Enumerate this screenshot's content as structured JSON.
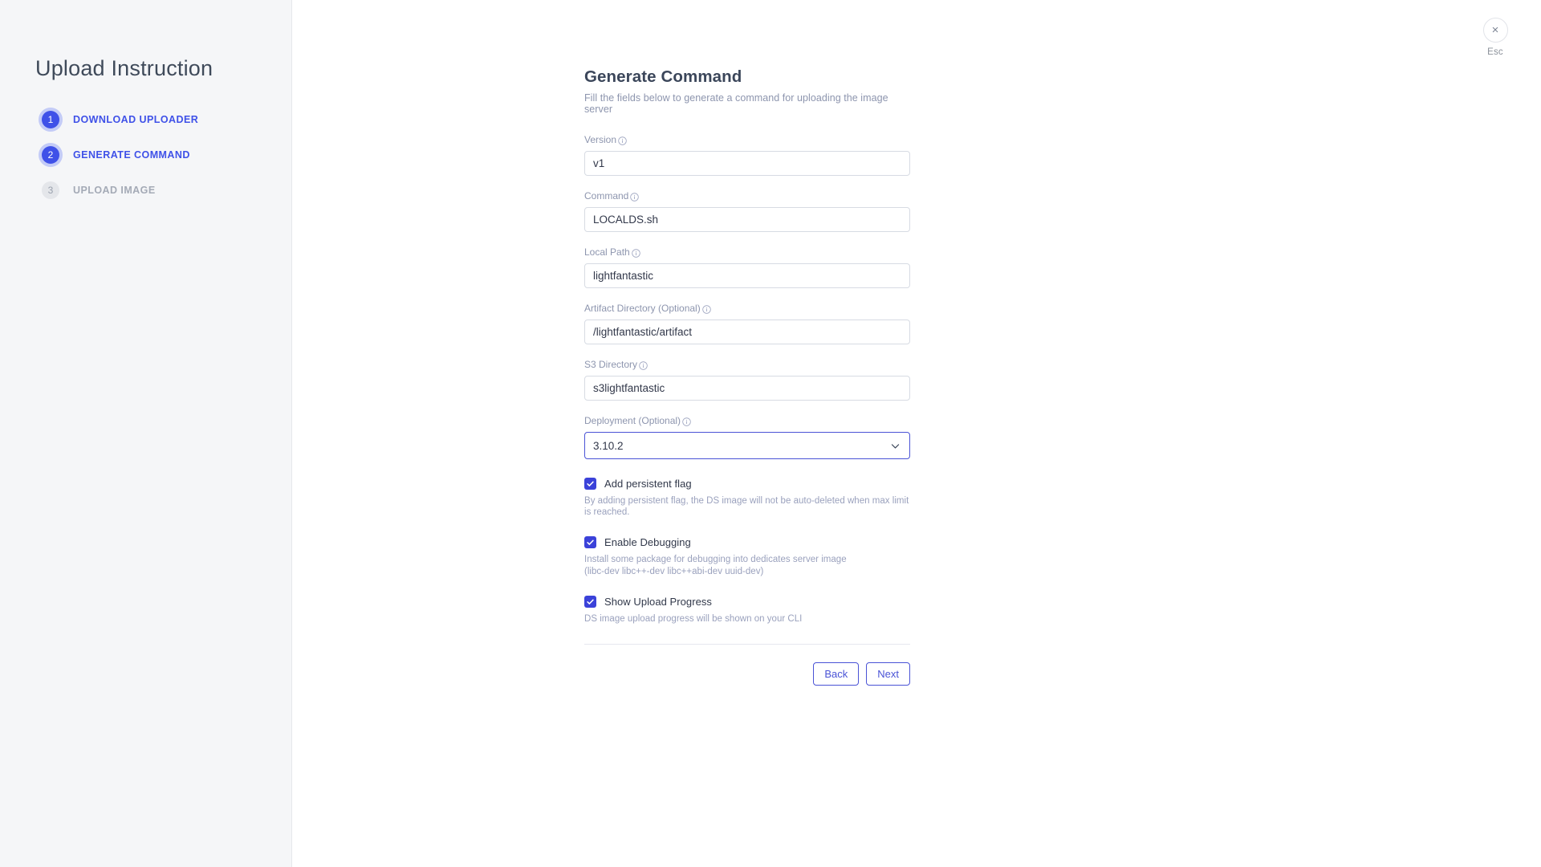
{
  "sidebar": {
    "title": "Upload Instruction",
    "steps": [
      {
        "number": "1",
        "label": "DOWNLOAD UPLOADER",
        "state": "done"
      },
      {
        "number": "2",
        "label": "GENERATE COMMAND",
        "state": "active"
      },
      {
        "number": "3",
        "label": "UPLOAD IMAGE",
        "state": "idle"
      }
    ]
  },
  "close": {
    "icon": "close-icon",
    "symbol": "×",
    "hint": "Esc"
  },
  "form": {
    "title": "Generate Command",
    "subtitle": "Fill the fields below to generate a command for uploading the image server",
    "fields": [
      {
        "label": "Version",
        "value": "v1",
        "info_icon": "info-circle-icon"
      },
      {
        "label": "Command",
        "value": "LOCALDS.sh",
        "info_icon": "info-circle-icon"
      },
      {
        "label": "Local Path",
        "value": "lightfantastic",
        "info_icon": "info-circle-icon"
      },
      {
        "label": "Artifact Directory (Optional)",
        "value": "/lightfantastic/artifact",
        "info_icon": "info-circle-icon"
      },
      {
        "label": "S3 Directory",
        "value": "s3lightfantastic",
        "info_icon": "info-circle-icon"
      }
    ],
    "select": {
      "label": "Deployment (Optional)",
      "value": "3.10.2",
      "info_icon": "info-circle-icon",
      "chevron_icon": "chevron-down-icon",
      "focused": true
    },
    "checkboxes": [
      {
        "label": "Add persistent flag",
        "checked": true,
        "help": "By adding persistent flag, the DS image will not be auto-deleted when max limit is reached."
      },
      {
        "label": "Enable Debugging",
        "checked": true,
        "help": "Install some package for debugging into dedicates server image",
        "help2": "(libc-dev libc++-dev libc++abi-dev uuid-dev)"
      },
      {
        "label": "Show Upload Progress",
        "checked": true,
        "help": "DS image upload progress will be shown on your CLI"
      }
    ],
    "buttons": {
      "back": "Back",
      "next": "Next"
    }
  },
  "colors": {
    "accent": "#3f51e8",
    "accent_border": "#4a53d6",
    "checkbox_fill": "#3b42d9",
    "sidebar_bg": "#f5f6f8",
    "label_muted": "#8d95ae",
    "title": "#3b465a"
  }
}
